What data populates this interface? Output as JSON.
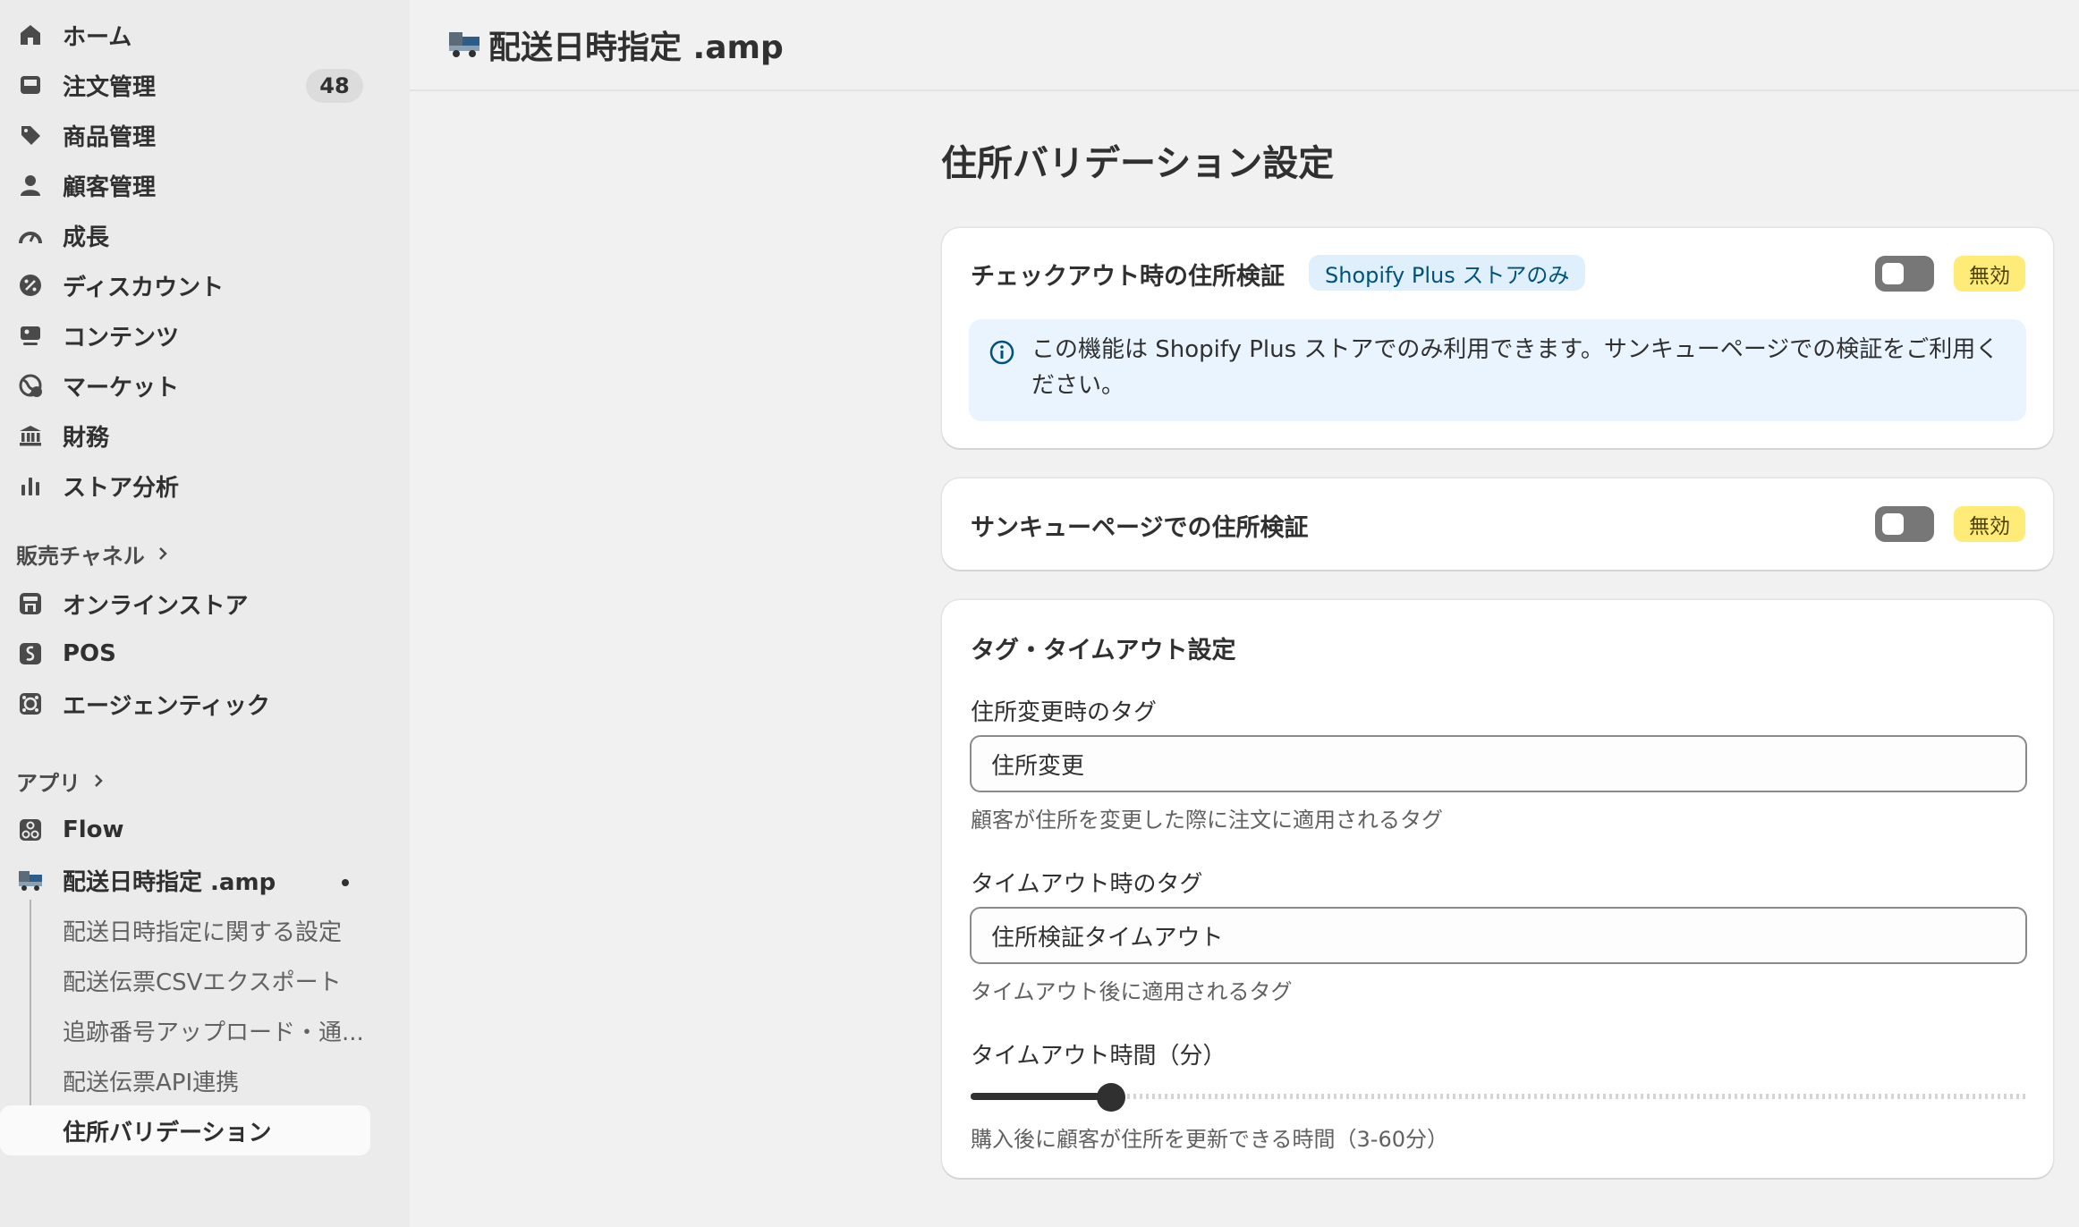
{
  "sidebar": {
    "nav": [
      {
        "label": "ホーム",
        "icon": "home-icon"
      },
      {
        "label": "注文管理",
        "icon": "inbox-icon",
        "count": "48"
      },
      {
        "label": "商品管理",
        "icon": "tag-icon"
      },
      {
        "label": "顧客管理",
        "icon": "person-icon"
      },
      {
        "label": "成長",
        "icon": "gauge-icon"
      },
      {
        "label": "ディスカウント",
        "icon": "discount-icon"
      },
      {
        "label": "コンテンツ",
        "icon": "content-icon"
      },
      {
        "label": "マーケット",
        "icon": "globe-icon"
      },
      {
        "label": "財務",
        "icon": "bank-icon"
      },
      {
        "label": "ストア分析",
        "icon": "bar-chart-icon"
      }
    ],
    "sales_channels_heading": "販売チャネル",
    "channels": [
      {
        "label": "オンラインストア",
        "icon": "store-icon"
      },
      {
        "label": "POS",
        "icon": "pos-icon"
      },
      {
        "label": "エージェンティック",
        "icon": "agentic-icon"
      }
    ],
    "apps_heading": "アプリ",
    "apps": [
      {
        "label": "Flow",
        "icon": "flow-icon"
      },
      {
        "label": "配送日時指定 .amp",
        "icon": "delivery-app-icon"
      }
    ],
    "app_subitems": [
      "配送日時指定に関する設定",
      "配送伝票CSVエクスポート",
      "追跡番号アップロード・通...",
      "配送伝票API連携",
      "住所バリデーション"
    ]
  },
  "topbar": {
    "title": "配送日時指定 .amp"
  },
  "page": {
    "title": "住所バリデーション設定",
    "checkout_card": {
      "title": "チェックアウト時の住所検証",
      "badge": "Shopify Plus ストアのみ",
      "status": "無効",
      "enabled": false,
      "banner": "この機能は Shopify Plus ストアでのみ利用できます。サンキューページでの検証をご利用ください。"
    },
    "thankyou_card": {
      "title": "サンキューページでの住所検証",
      "status": "無効",
      "enabled": false
    },
    "tags_card": {
      "title": "タグ・タイムアウト設定",
      "address_change_label": "住所変更時のタグ",
      "address_change_value": "住所変更",
      "address_change_help": "顧客が住所を変更した際に注文に適用されるタグ",
      "timeout_tag_label": "タイムアウト時のタグ",
      "timeout_tag_value": "住所検証タイムアウト",
      "timeout_tag_help": "タイムアウト後に適用されるタグ",
      "timeout_minutes_label": "タイムアウト時間（分）",
      "timeout_minutes_help": "購入後に顧客が住所を更新できる時間（3-60分）",
      "timeout_minutes_value": 10,
      "timeout_minutes_min": 3,
      "timeout_minutes_max": 60
    }
  },
  "colors": {
    "accent": "#303030",
    "status_badge": "#ffeb78",
    "info_banner": "#eaf4ff",
    "plus_badge": "#dff0fc"
  }
}
